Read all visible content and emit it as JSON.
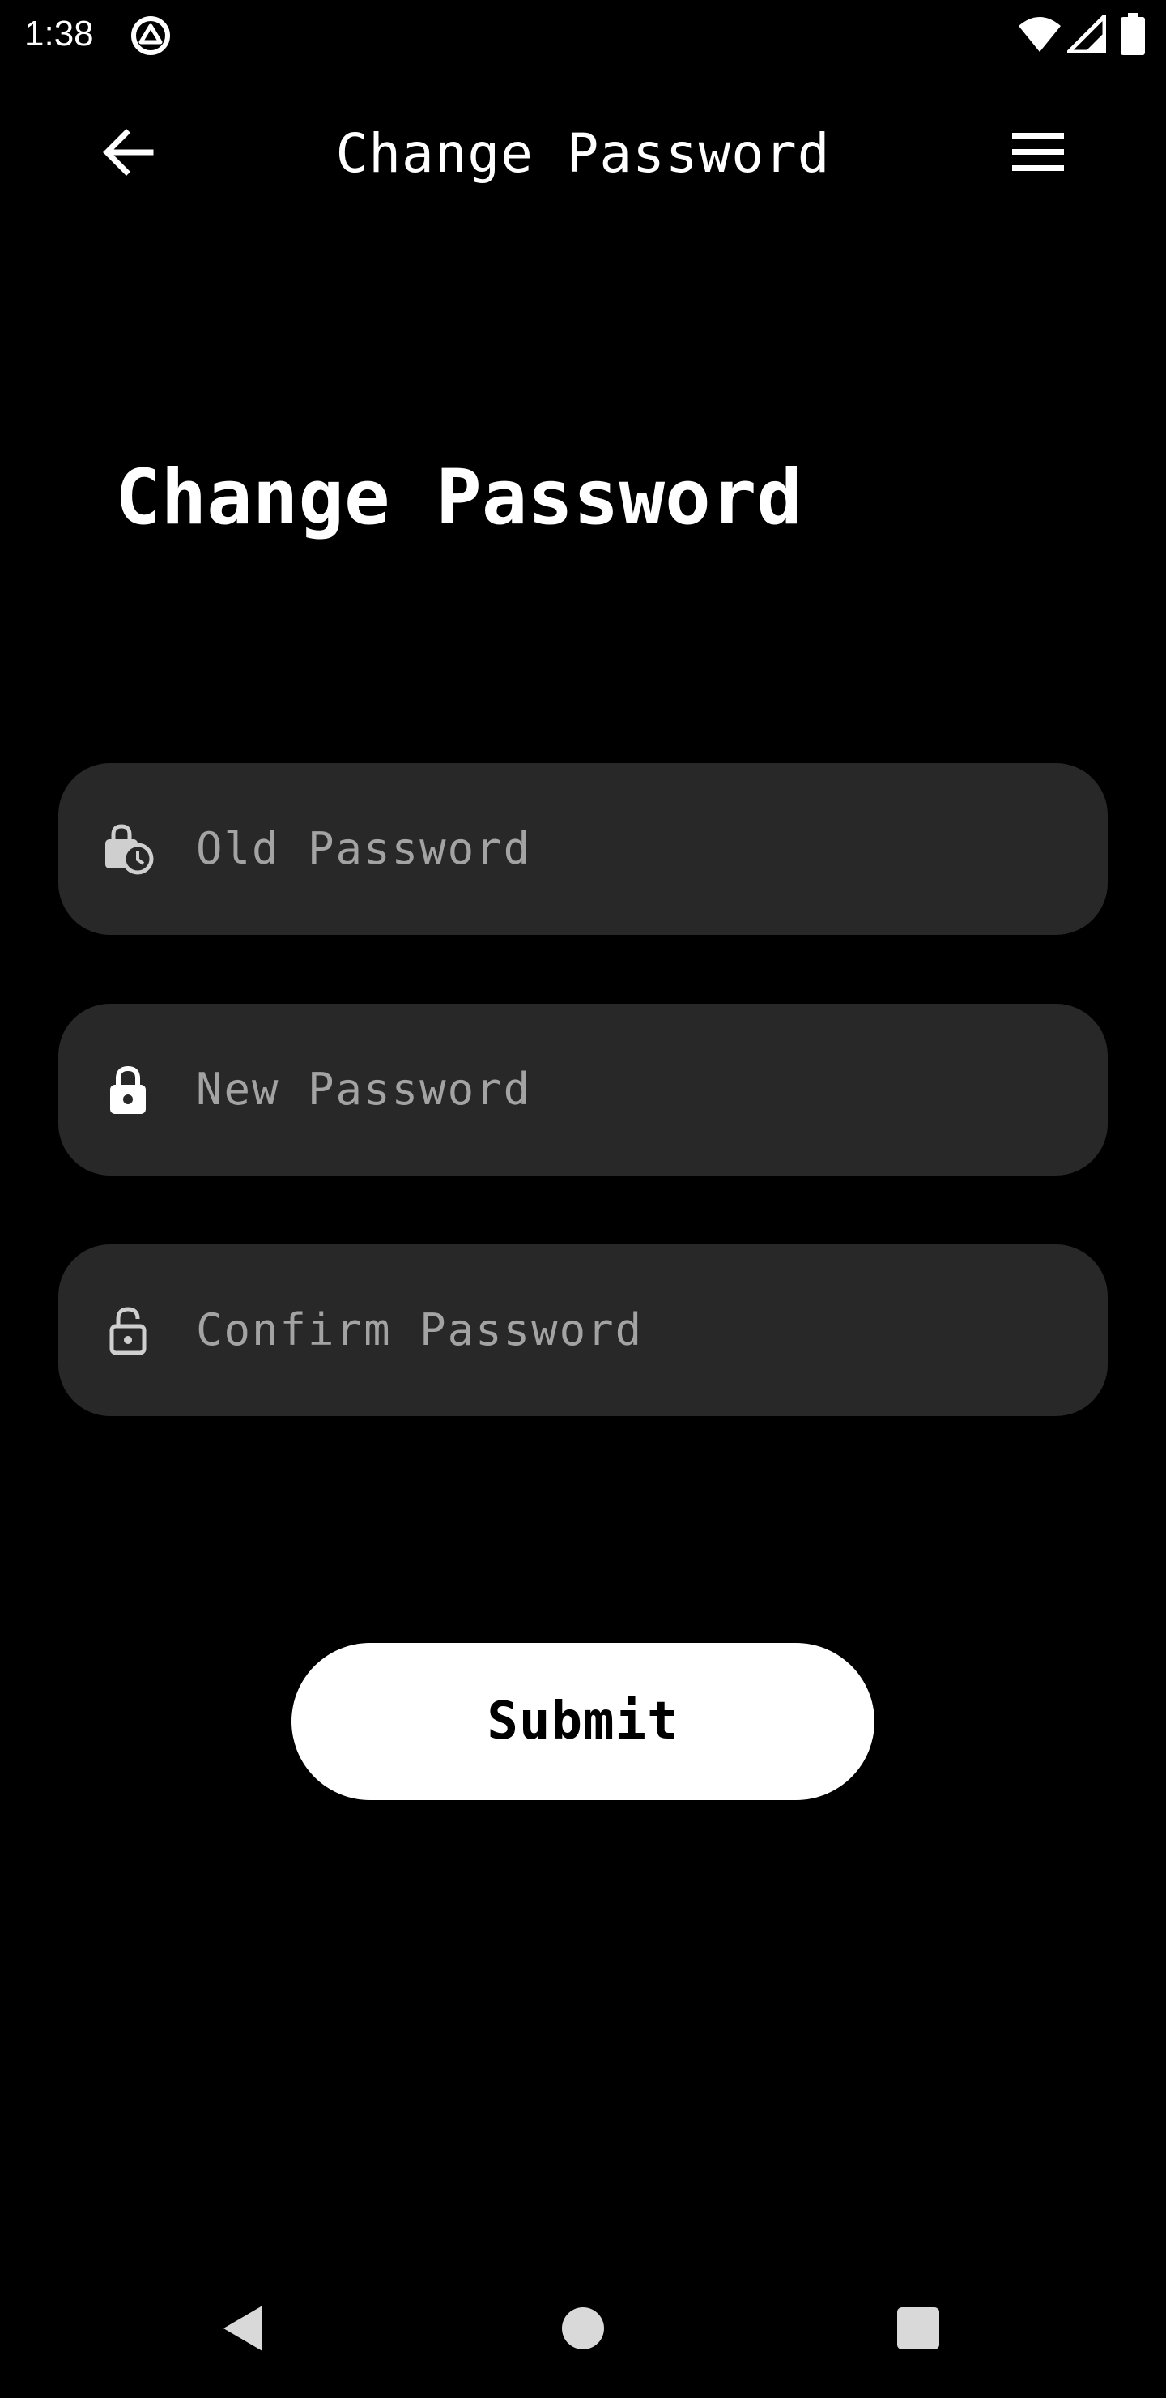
{
  "status_bar": {
    "time": "1:38",
    "icons": [
      "app-notification-icon",
      "wifi-icon",
      "cell-signal-icon",
      "battery-icon"
    ]
  },
  "app_bar": {
    "title": "Change Password",
    "back_icon": "arrow-left-icon",
    "menu_icon": "hamburger-menu-icon"
  },
  "main": {
    "heading": "Change Password",
    "fields": [
      {
        "placeholder": "Old Password",
        "value": "",
        "icon": "lock-clock-icon"
      },
      {
        "placeholder": "New Password",
        "value": "",
        "icon": "lock-filled-icon"
      },
      {
        "placeholder": "Confirm Password",
        "value": "",
        "icon": "lock-open-icon"
      }
    ],
    "submit_label": "Submit"
  },
  "nav_bar": {
    "icons": [
      "nav-back-icon",
      "nav-home-icon",
      "nav-recents-icon"
    ]
  },
  "colors": {
    "background": "#000000",
    "field_background": "#282828",
    "placeholder": "#a3a3a3",
    "button_background": "#ffffff",
    "button_text": "#000000"
  }
}
